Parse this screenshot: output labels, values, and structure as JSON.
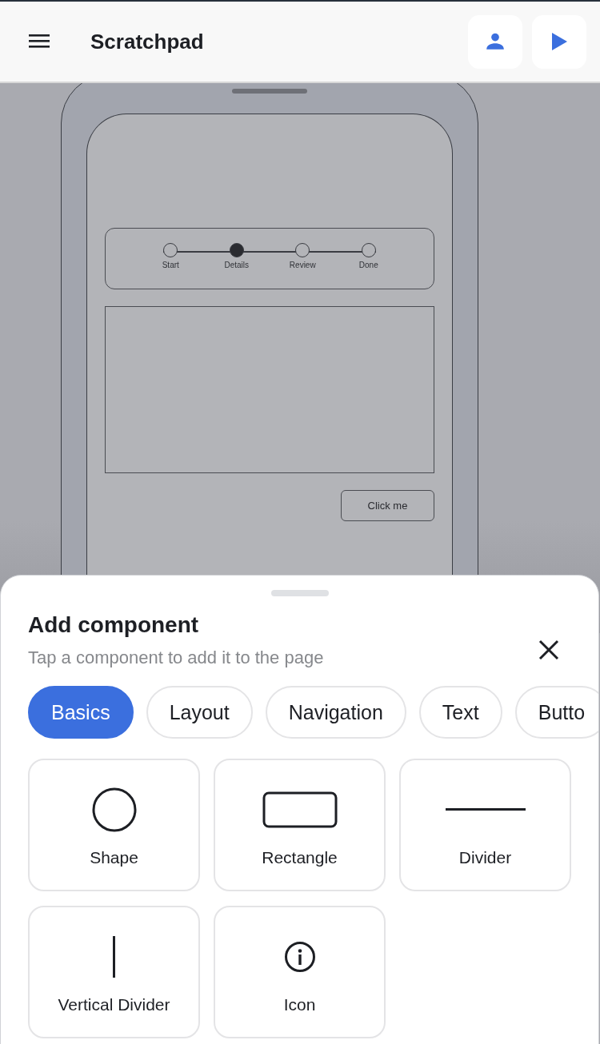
{
  "app_bar": {
    "title": "Scratchpad"
  },
  "mockup": {
    "stepper": [
      {
        "label": "Start",
        "current": false
      },
      {
        "label": "Details",
        "current": true
      },
      {
        "label": "Review",
        "current": false
      },
      {
        "label": "Done",
        "current": false
      }
    ],
    "button": "Click me"
  },
  "sheet": {
    "title": "Add component",
    "subtitle": "Tap a component to add it to the page",
    "categories": [
      {
        "label": "Basics",
        "selected": true
      },
      {
        "label": "Layout",
        "selected": false
      },
      {
        "label": "Navigation",
        "selected": false
      },
      {
        "label": "Text",
        "selected": false
      },
      {
        "label": "Butto",
        "selected": false
      }
    ],
    "components": [
      {
        "label": "Shape",
        "kind": "circle"
      },
      {
        "label": "Rectangle",
        "kind": "rectangle"
      },
      {
        "label": "Divider",
        "kind": "hline"
      },
      {
        "label": "Vertical Divider",
        "kind": "vline"
      },
      {
        "label": "Icon",
        "kind": "info"
      }
    ]
  }
}
